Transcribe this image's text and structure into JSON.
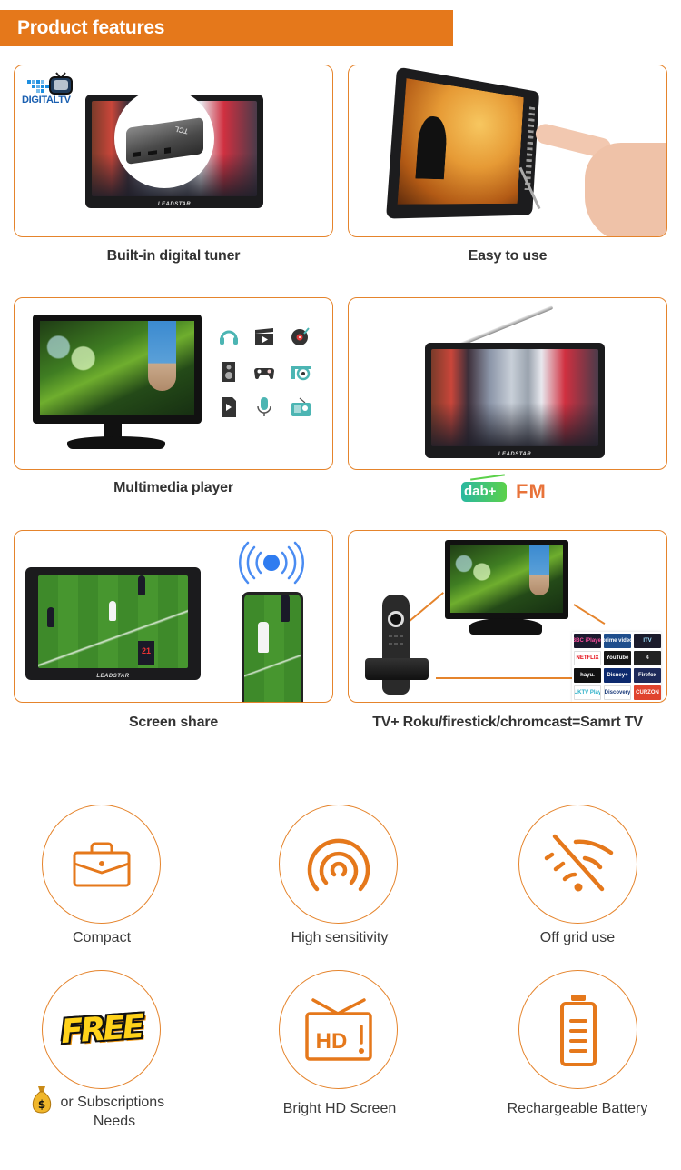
{
  "header": {
    "title": "Product features"
  },
  "colors": {
    "accent": "#e5781b",
    "border": "#e5842c",
    "teal": "#4cb5b3",
    "text": "#333333"
  },
  "cards": [
    {
      "id": "digital-tuner",
      "label": "Built-in digital tuner",
      "logo_text": "DIGITALTV",
      "box_brand": "TCL",
      "tv_brand": "LEADSTAR"
    },
    {
      "id": "easy-to-use",
      "label": "Easy to use"
    },
    {
      "id": "multimedia",
      "label": "Multimedia player",
      "icons": [
        "headphones-icon",
        "clapperboard-icon",
        "vinyl-record-icon",
        "speaker-icon",
        "gamepad-icon",
        "camera-icon",
        "video-file-icon",
        "microphone-icon",
        "radio-icon"
      ]
    },
    {
      "id": "radio",
      "label_logos": [
        "dab+",
        "FM"
      ],
      "tv_brand": "LEADSTAR"
    },
    {
      "id": "screen-share",
      "label": "Screen share",
      "tv_brand": "LEADSTAR",
      "jersey_number": "21"
    },
    {
      "id": "smart-tv",
      "label": "TV+ Roku/firestick/chromcast=Samrt TV",
      "apps": [
        {
          "name": "BBC iPlayer",
          "bg": "#1a1a2e",
          "fg": "#ff4fa0"
        },
        {
          "name": "prime video",
          "bg": "#1f4e8c",
          "fg": "#ffffff"
        },
        {
          "name": "ITV",
          "bg": "#1b1b2b",
          "fg": "#9fe3ff"
        },
        {
          "name": "NETFLIX",
          "bg": "#ffffff",
          "fg": "#e50914"
        },
        {
          "name": "YouTube",
          "bg": "#151515",
          "fg": "#ffffff"
        },
        {
          "name": "4",
          "bg": "#222222",
          "fg": "#dddddd"
        },
        {
          "name": "hayu.",
          "bg": "#111111",
          "fg": "#ffffff"
        },
        {
          "name": "Disney+",
          "bg": "#0d2a6e",
          "fg": "#ffffff"
        },
        {
          "name": "Firefox",
          "bg": "#1e2a5a",
          "fg": "#ffffff"
        },
        {
          "name": "UKTV Play",
          "bg": "#ffffff",
          "fg": "#2bb0c8"
        },
        {
          "name": "Discovery",
          "bg": "#ffffff",
          "fg": "#1a3a7a"
        },
        {
          "name": "CURZON",
          "bg": "#e0442e",
          "fg": "#ffffff"
        }
      ]
    }
  ],
  "features": [
    {
      "icon": "briefcase-icon",
      "label": "Compact"
    },
    {
      "icon": "signal-arcs-icon",
      "label": "High sensitivity"
    },
    {
      "icon": "wifi-off-icon",
      "label": "Off grid use"
    },
    {
      "icon": "free-badge-icon",
      "badge_text": "FREE",
      "prefix_icon": "money-bag-icon",
      "label": "or Subscriptions",
      "label_line2": "Needs"
    },
    {
      "icon": "hd-tv-icon",
      "icon_text": "HD",
      "label": "Bright HD Screen"
    },
    {
      "icon": "battery-icon",
      "label": "Rechargeable Battery"
    }
  ]
}
